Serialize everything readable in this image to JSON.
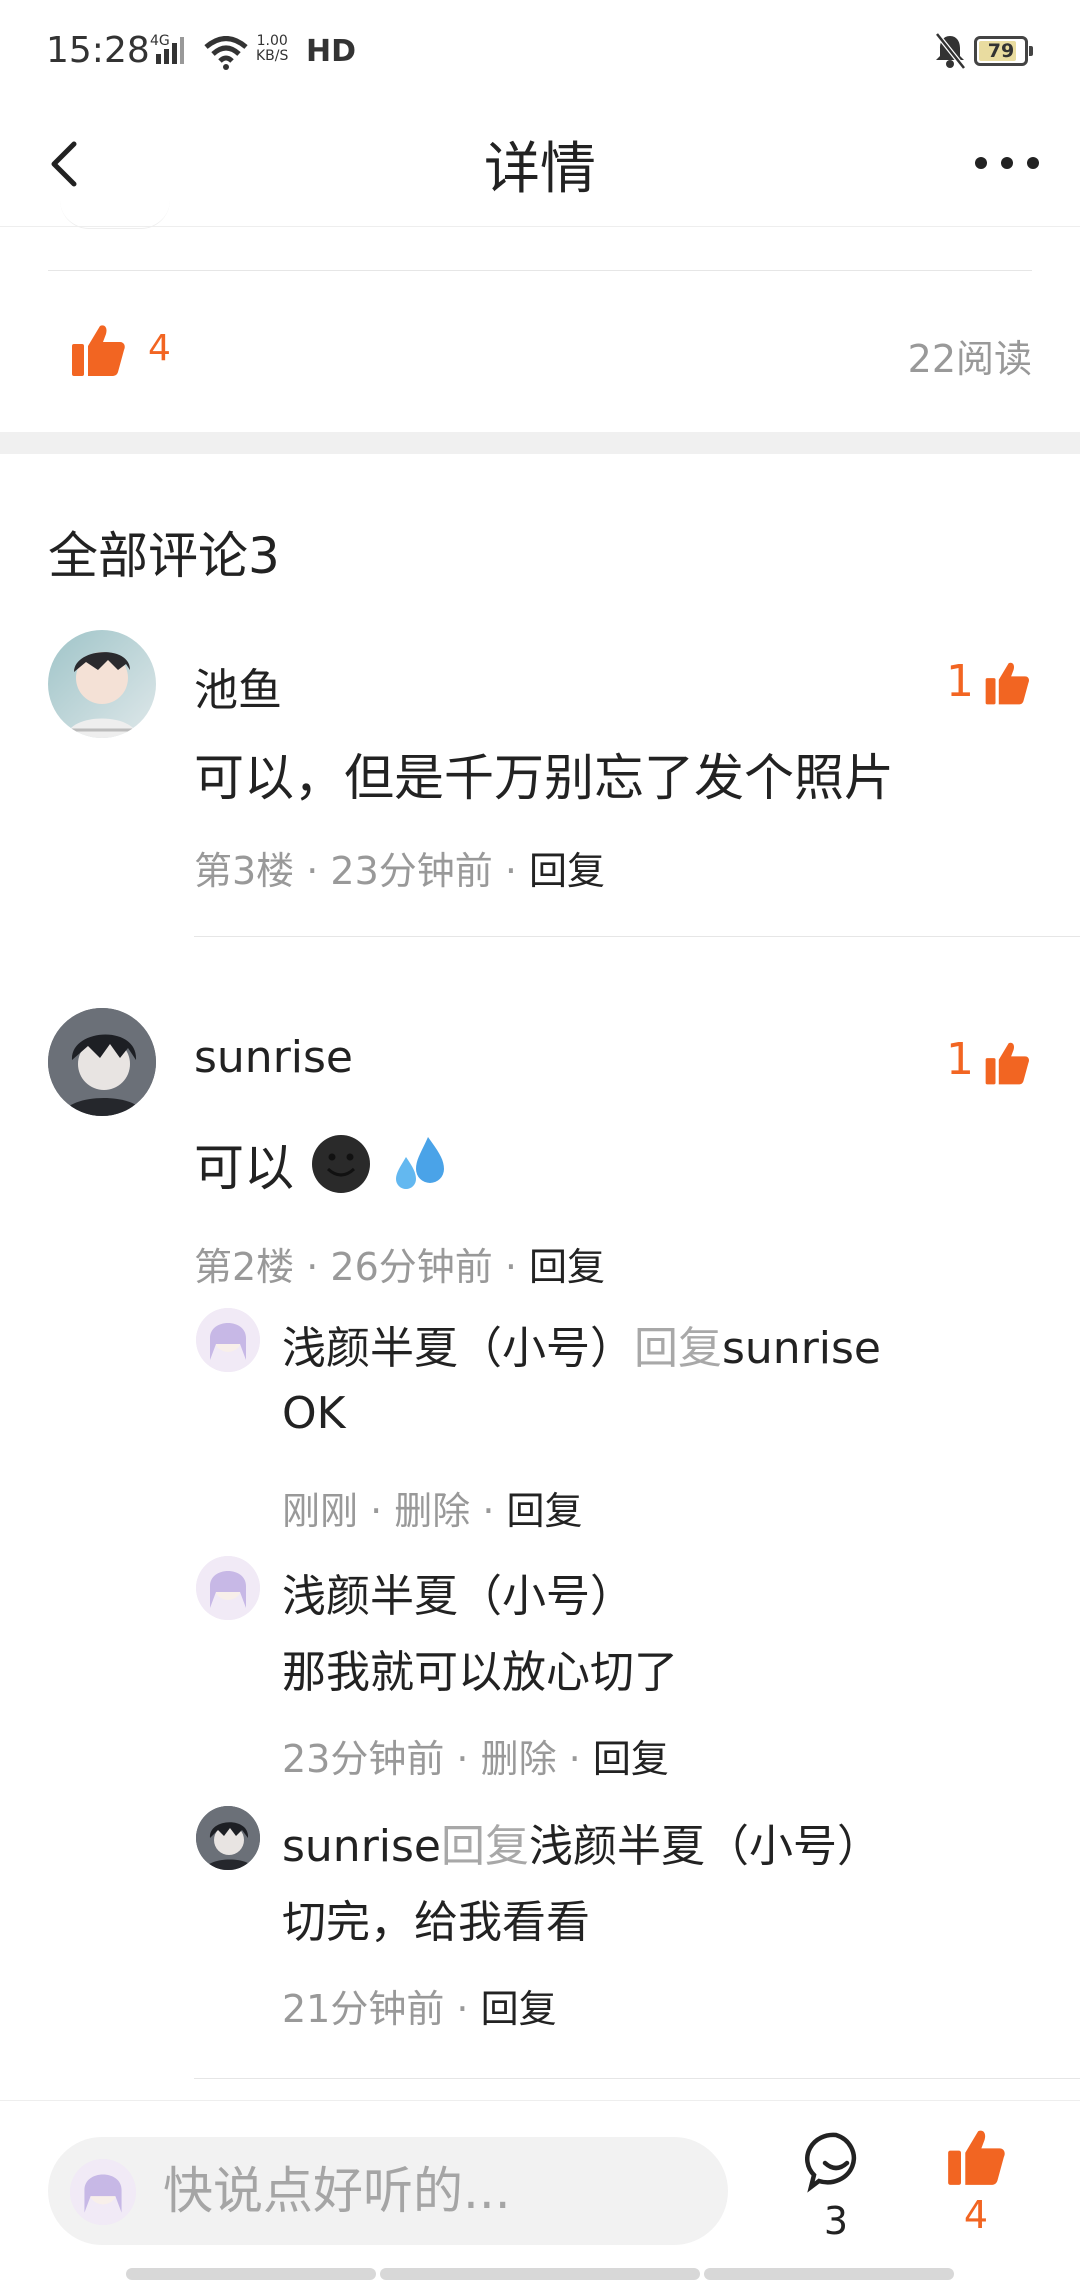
{
  "status_bar": {
    "time": "15:28",
    "network": "4G",
    "speed_value": "1.00",
    "speed_unit": "KB/S",
    "hd": "HD",
    "battery": "79"
  },
  "nav": {
    "title": "详情"
  },
  "post_stats": {
    "likes": "4",
    "reads": "22阅读"
  },
  "comments_header": "全部评论3",
  "comments": [
    {
      "name": "池鱼",
      "likes": "1",
      "content": "可以，但是千万别忘了发个照片",
      "meta": "第3楼 · 23分钟前 · ",
      "reply": "回复"
    },
    {
      "name": "sunrise",
      "likes": "1",
      "content": "可以",
      "meta": "第2楼 · 26分钟前 · ",
      "reply": "回复",
      "replies": [
        {
          "author": "浅颜半夏（小号）",
          "reply_word": "回复",
          "target": "sunrise",
          "text": "OK",
          "meta": "刚刚 · 删除 · ",
          "reply": "回复"
        },
        {
          "author": "浅颜半夏（小号）",
          "text": "那我就可以放心切了",
          "meta": "23分钟前 · 删除 · ",
          "reply": "回复"
        },
        {
          "author": "sunrise",
          "reply_word": "回复",
          "target": "浅颜半夏（小号）",
          "text": "切完，给我看看",
          "meta": "21分钟前 · ",
          "reply": "回复"
        }
      ]
    }
  ],
  "bottom_bar": {
    "placeholder": "快说点好听的...",
    "comment_count": "3",
    "like_count": "4"
  },
  "colors": {
    "accent": "#f26522",
    "muted": "#999999",
    "divider": "#e6e6e6"
  }
}
